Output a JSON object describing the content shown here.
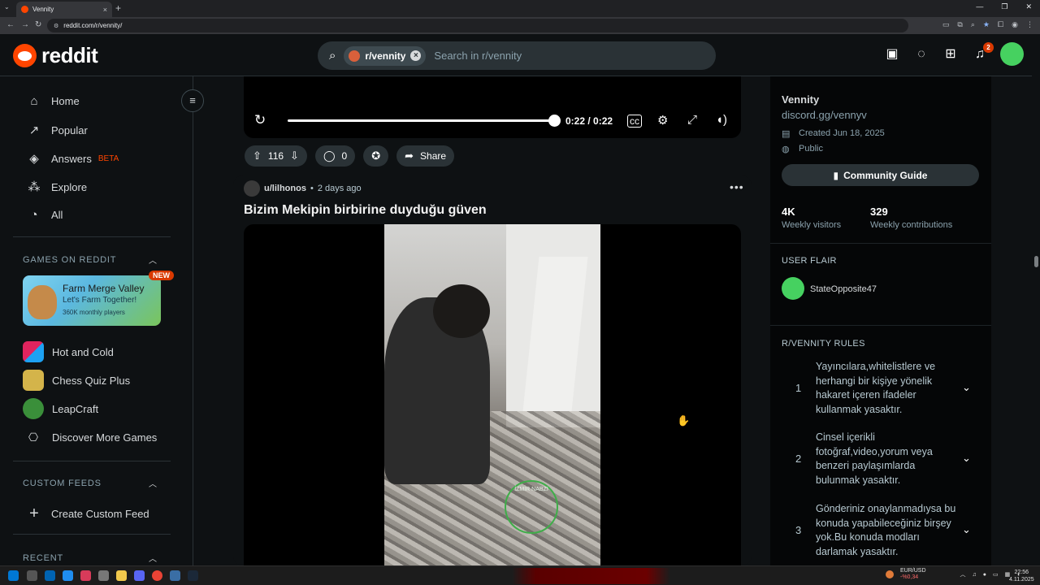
{
  "browser": {
    "tab_title": "Vennity",
    "url": "reddit.com/r/vennity/",
    "new_tab": "+",
    "close": "×"
  },
  "header": {
    "logo_text": "reddit",
    "search_chip": "r/vennity",
    "search_placeholder": "Search in r/vennity",
    "notification_count": "2"
  },
  "sidebar": {
    "nav": [
      {
        "label": "Home",
        "icon": "home-icon"
      },
      {
        "label": "Popular",
        "icon": "popular-icon"
      },
      {
        "label": "Answers",
        "icon": "answers-icon",
        "badge": "BETA"
      },
      {
        "label": "Explore",
        "icon": "explore-icon"
      },
      {
        "label": "All",
        "icon": "all-icon"
      }
    ],
    "games_heading": "GAMES ON REDDIT",
    "featured_game": {
      "title": "Farm Merge Valley",
      "subtitle": "Let's Farm Together!",
      "meta": "360K monthly players",
      "tag": "NEW"
    },
    "games": [
      {
        "label": "Hot and Cold"
      },
      {
        "label": "Chess Quiz Plus"
      },
      {
        "label": "LeapCraft"
      },
      {
        "label": "Discover More Games"
      }
    ],
    "custom_heading": "CUSTOM FEEDS",
    "create_feed": "Create Custom Feed",
    "recent_heading": "RECENT"
  },
  "video_player": {
    "time": "0:22 / 0:22",
    "progress": 1.0
  },
  "actions": {
    "votes": "116",
    "comments": "0",
    "share": "Share"
  },
  "post": {
    "author": "u/lilhonos",
    "separator": "•",
    "age": "2 days ago",
    "title": "Bizim Mekipin birbirine duyduğu güven",
    "watermark": "İZMİR NABZI"
  },
  "community": {
    "name": "Vennity",
    "link": "discord.gg/vennyv",
    "created": "Created Jun 18, 2025",
    "visibility": "Public",
    "guide_button": "Community Guide",
    "stats": [
      {
        "value": "4K",
        "label": "Weekly visitors"
      },
      {
        "value": "329",
        "label": "Weekly contributions"
      }
    ],
    "flair_heading": "USER FLAIR",
    "flair_user": "StateOpposite47",
    "rules_heading": "R/VENNITY RULES",
    "rules": [
      {
        "num": "1",
        "text": "Yayıncılara,whitelistlere ve herhangi bir kişiye yönelik hakaret içeren ifadeler kullanmak yasaktır."
      },
      {
        "num": "2",
        "text": "Cinsel içerikli fotoğraf,video,yorum veya benzeri paylaşımlarda bulunmak yasaktır."
      },
      {
        "num": "3",
        "text": "Gönderiniz onaylanmadıysa bu konuda yapabileceğiniz birşey yok.Bu konuda modları darlamak yasaktır."
      }
    ]
  },
  "taskbar": {
    "ticker_name": "EUR/USD",
    "ticker_value": "-%0,34",
    "time": "22:56",
    "date": "4.11.2025"
  }
}
